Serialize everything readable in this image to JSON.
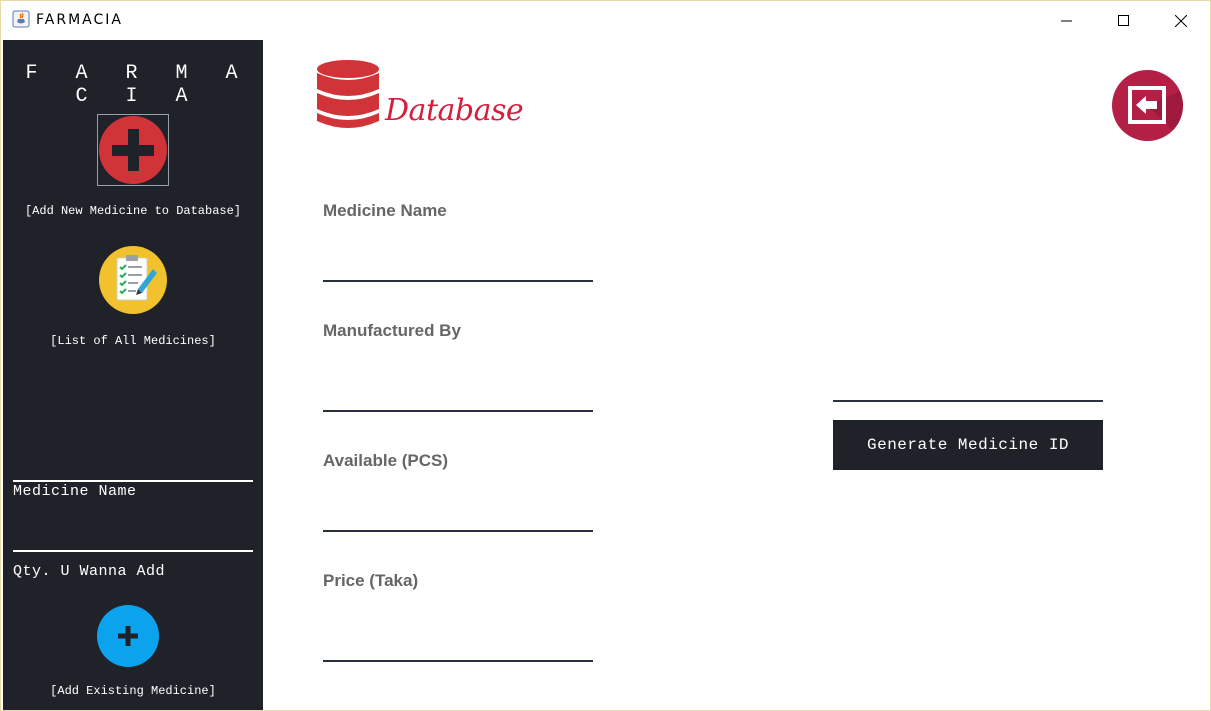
{
  "window": {
    "title": "FARMACIA"
  },
  "sidebar": {
    "brand": "F A R M A C I A",
    "add_new_label": "[Add New Medicine to Database]",
    "list_all_label": "[List of All Medicines]",
    "medicine_name_label": "Medicine Name",
    "qty_label": "Qty. U Wanna Add",
    "add_existing_label": "[Add Existing Medicine]"
  },
  "main": {
    "logo_text": "Database",
    "fields": {
      "medicine_name": {
        "label": "Medicine Name",
        "value": ""
      },
      "manufactured_by": {
        "label": "Manufactured By",
        "value": ""
      },
      "available": {
        "label": "Available (PCS)",
        "value": ""
      },
      "price": {
        "label": "Price (Taka)",
        "value": ""
      }
    },
    "medicine_id_value": "",
    "generate_button": "Generate Medicine ID"
  },
  "colors": {
    "sidebar_bg": "#1f2229",
    "accent_red": "#d3203f",
    "back_button": "#b41f46",
    "add_button_blue": "#0ba3ee",
    "label_gray": "#666666"
  },
  "icons": {
    "app": "java-cup-icon",
    "add_new": "red-plus-icon",
    "list_all": "checklist-icon",
    "add_existing": "blue-plus-icon",
    "back": "back-arrow-icon",
    "database": "database-icon"
  }
}
